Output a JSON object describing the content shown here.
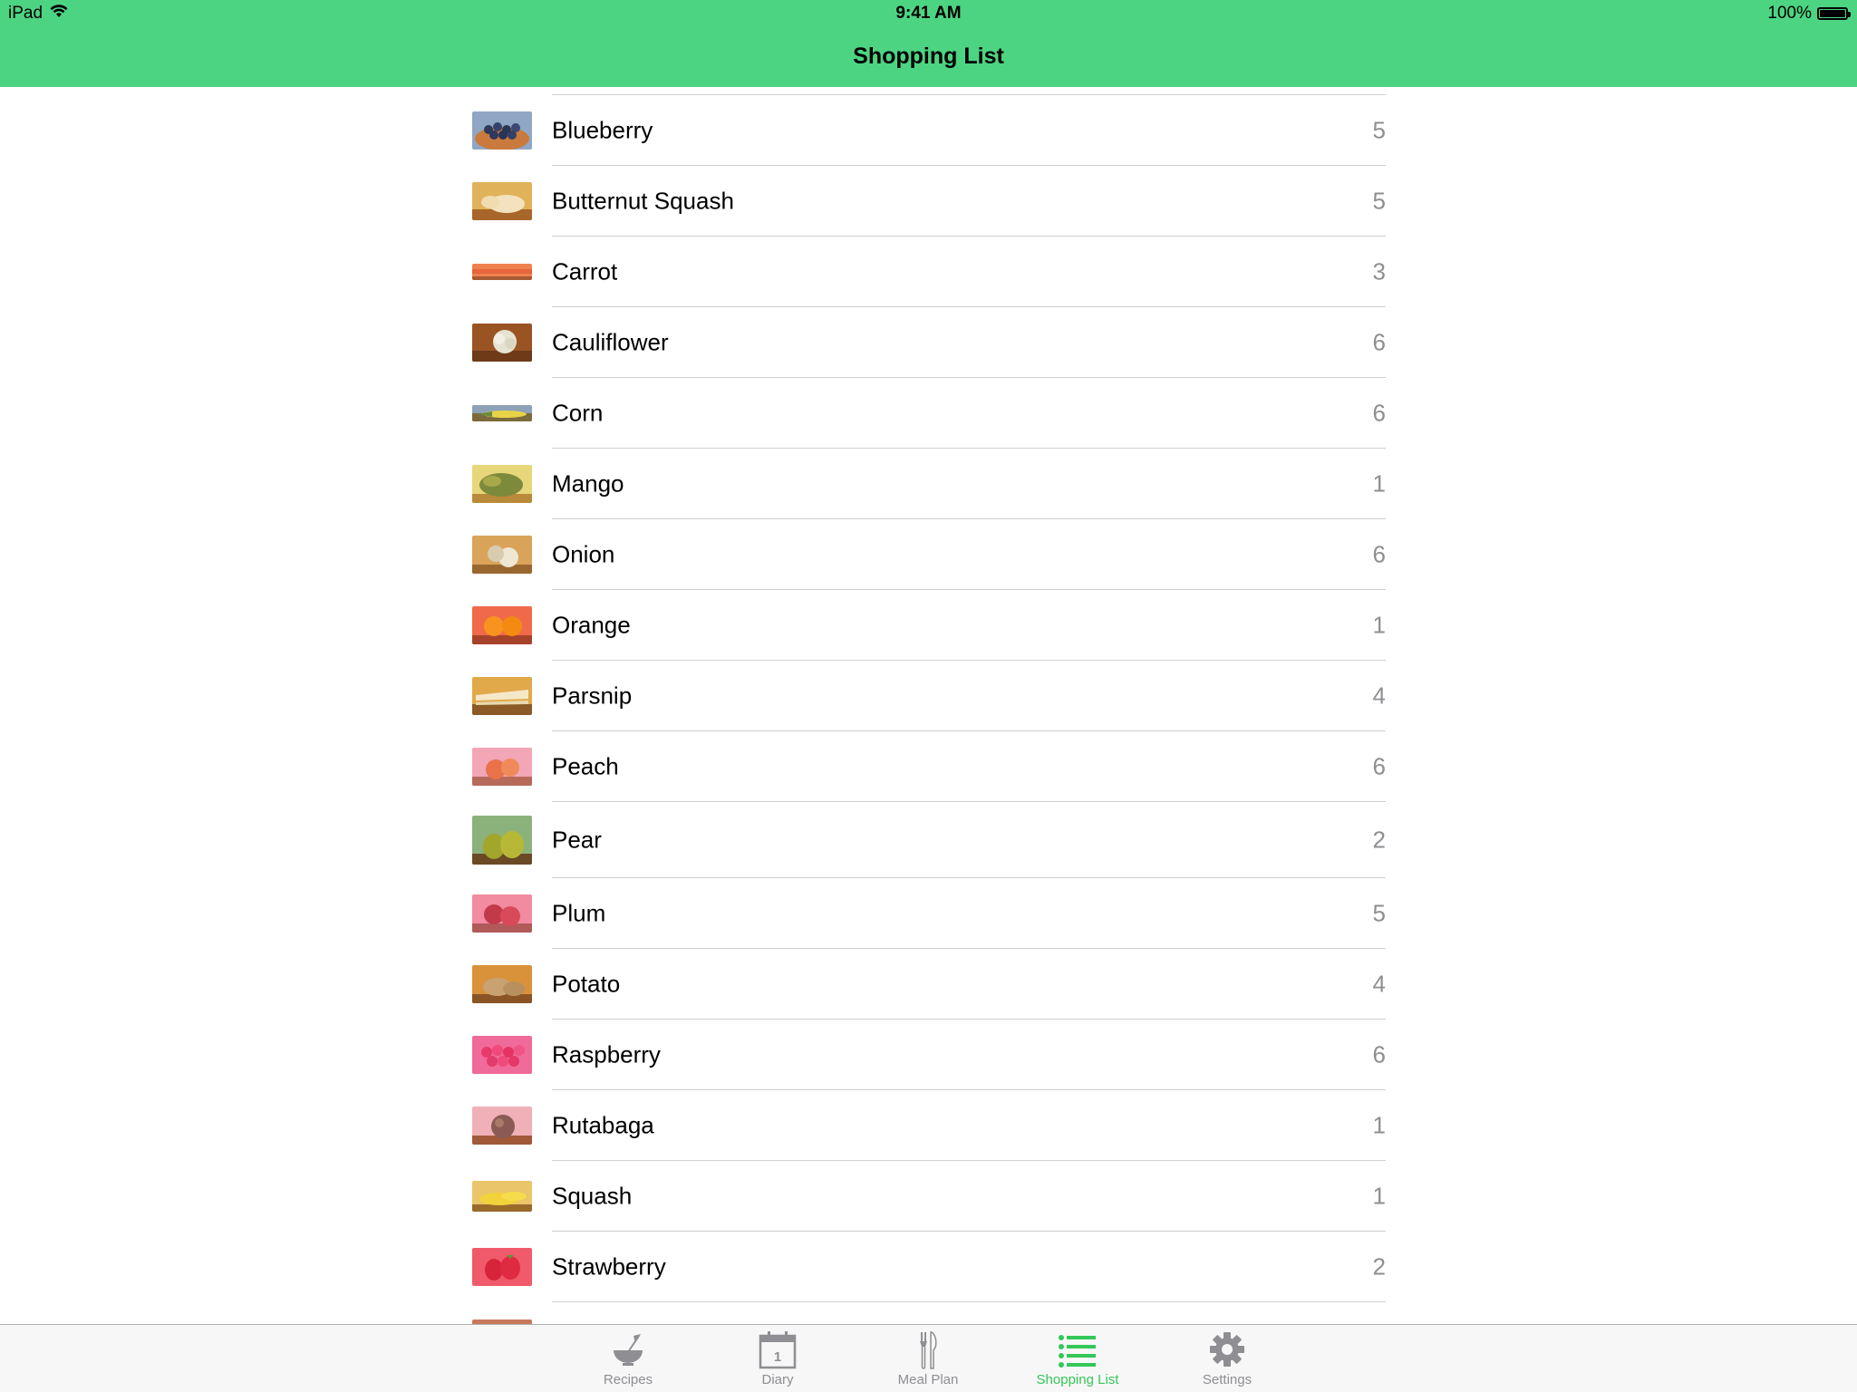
{
  "status_bar": {
    "device": "iPad",
    "time": "9:41 AM",
    "battery": "100%"
  },
  "nav": {
    "title": "Shopping List"
  },
  "items": [
    {
      "name": "Blueberry",
      "count": "5"
    },
    {
      "name": "Butternut Squash",
      "count": "5"
    },
    {
      "name": "Carrot",
      "count": "3"
    },
    {
      "name": "Cauliflower",
      "count": "6"
    },
    {
      "name": "Corn",
      "count": "6"
    },
    {
      "name": "Mango",
      "count": "1"
    },
    {
      "name": "Onion",
      "count": "6"
    },
    {
      "name": "Orange",
      "count": "1"
    },
    {
      "name": "Parsnip",
      "count": "4"
    },
    {
      "name": "Peach",
      "count": "6"
    },
    {
      "name": "Pear",
      "count": "2"
    },
    {
      "name": "Plum",
      "count": "5"
    },
    {
      "name": "Potato",
      "count": "4"
    },
    {
      "name": "Raspberry",
      "count": "6"
    },
    {
      "name": "Rutabaga",
      "count": "1"
    },
    {
      "name": "Squash",
      "count": "1"
    },
    {
      "name": "Strawberry",
      "count": "2"
    }
  ],
  "tabs": [
    {
      "label": "Recipes",
      "icon": "mixing-bowl-icon"
    },
    {
      "label": "Diary",
      "icon": "calendar-icon",
      "calendar_day": "1"
    },
    {
      "label": "Meal Plan",
      "icon": "fork-knife-icon"
    },
    {
      "label": "Shopping List",
      "icon": "list-icon",
      "active": true
    },
    {
      "label": "Settings",
      "icon": "gear-icon"
    }
  ],
  "colors": {
    "header": "#4cd482",
    "active_tab": "#34c759",
    "inactive_tab": "#8e8e93",
    "count_text": "#8e8e93"
  }
}
